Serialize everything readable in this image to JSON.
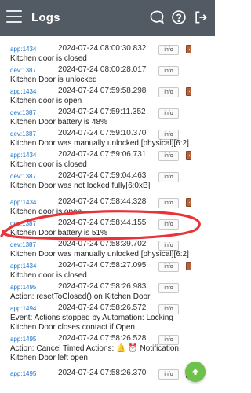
{
  "header": {
    "title": "Logs"
  },
  "logs": [
    {
      "device": "app:1434",
      "timestamp": "2024-07-24 08:00:30.832",
      "message": "Kitchen door is closed",
      "level": "info"
    },
    {
      "device": "dev:1387",
      "timestamp": "2024-07-24 08:00:28.017",
      "message": "Kitchen Door is unlocked",
      "level": "info"
    },
    {
      "device": "app:1434",
      "timestamp": "2024-07-24 07:59:58.298",
      "message": "Kitchen door is open",
      "level": "info"
    },
    {
      "device": "dev:1387",
      "timestamp": "2024-07-24 07:59:11.352",
      "message": "Kitchen Door battery is 48%",
      "level": "info"
    },
    {
      "device": "dev:1387",
      "timestamp": "2024-07-24 07:59:10.370",
      "message": "Kitchen Door was manually unlocked [physical][6:2]",
      "level": "info"
    },
    {
      "device": "app:1434",
      "timestamp": "2024-07-24 07:59:06.731",
      "message": "Kitchen door is closed",
      "level": "info"
    },
    {
      "device": "dev:1387",
      "timestamp": "2024-07-24 07:59:04.463",
      "message": "Kitchen Door was not locked fully[6:0xB]",
      "level": "info"
    },
    {
      "device": "app:1434",
      "timestamp": "2024-07-24 07:58:44.328",
      "message": "Kitchen door is open",
      "level": "info"
    },
    {
      "device": "dev:1387",
      "timestamp": "2024-07-24 07:58:44.155",
      "message": "Kitchen Door battery is 51%",
      "level": "info"
    },
    {
      "device": "dev:1387",
      "timestamp": "2024-07-24 07:58:39.702",
      "message": "Kitchen Door was manually unlocked [physical][6:2]",
      "level": "info"
    },
    {
      "device": "app:1434",
      "timestamp": "2024-07-24 07:58:27.095",
      "message": "Kitchen door is closed",
      "level": "info"
    },
    {
      "device": "app:1495",
      "timestamp": "2024-07-24 07:58:26.983",
      "message": "Action: resetToClosed() on Kitchen Door",
      "level": "info"
    },
    {
      "device": "app:1494",
      "timestamp": "2024-07-24 07:58:26.572",
      "message": "Event: Actions stopped by Automation: Locking Kitchen Door closes contact if Open",
      "level": "info"
    },
    {
      "device": "app:1495",
      "timestamp": "2024-07-24 07:58:26.528",
      "message": "Action: Cancel Timed Actions: 🔔 ⏰ Notification: Kitchen Door left open",
      "level": "info"
    },
    {
      "device": "app:1495",
      "timestamp": "2024-07-24 07:58:26.370",
      "message": "",
      "level": "info"
    }
  ],
  "icons": {
    "menu": "menu-icon",
    "chat": "chat-icon",
    "help": "help-icon",
    "logout": "logout-icon",
    "door": "door-icon",
    "scroll_top": "arrow-up-icon"
  },
  "colors": {
    "topbar": "#525a63",
    "device_link": "#1f73c9",
    "highlight": "#e8333a",
    "fab": "#6cc24a",
    "door": "#b4633f"
  }
}
